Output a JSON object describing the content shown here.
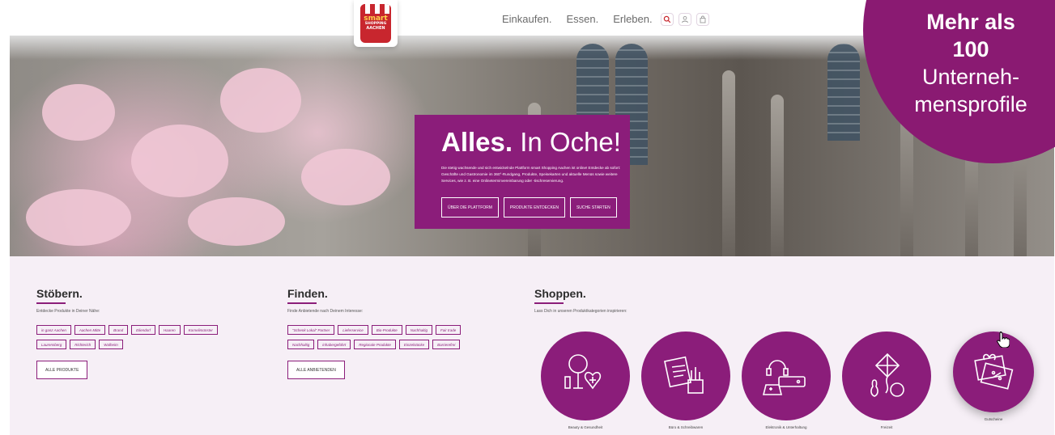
{
  "header": {
    "logo": {
      "line1": "smart",
      "line2": "SHOPPING",
      "line3": "AACHEN"
    },
    "nav": [
      "Einkaufen.",
      "Essen.",
      "Erleben."
    ],
    "icons": [
      "search-icon",
      "user-icon",
      "bag-icon"
    ]
  },
  "hero": {
    "title_bold": "Alles.",
    "title_rest": "In Oche!",
    "text": "Die stetig wachsende und sich entwickelnde Plattform smart Shopping Aachen ist online! Entdecke ab sofort: Geschäfte und Gastronomie im 360°-Rundgang, Produkte, Speisekarten und aktuelle Menüs sowie weitere Services, wie z. B. eine Onlineterminvereinbarung oder -tischreservierung.",
    "buttons": [
      "ÜBER DIE PLATTFORM",
      "PRODUKTE ENTDECKEN",
      "SUCHE STARTEN"
    ]
  },
  "promo": {
    "line1": "Mehr als",
    "line2": "100",
    "line3": "Unterneh-",
    "line4": "mensprofile"
  },
  "stoebern": {
    "title": "Stöbern.",
    "subtitle": "Entdecke Produkte in Deiner Nähe:",
    "tags_row1": [
      "in ganz Aachen",
      "Aachen Mitte",
      "Brand",
      "Eilendorf",
      "Haaren",
      "Kornelimünster"
    ],
    "tags_row2": [
      "Laurensberg",
      "Richterich",
      "Walheim"
    ],
    "button": "ALLE PRODUKTE"
  },
  "finden": {
    "title": "Finden.",
    "subtitle": "Finde Anbietende nach Deinem Interesse:",
    "tags_row1": [
      "\"Schenk Lokal\" Partner",
      "Lieferservice",
      "Bio-Produkte",
      "Nachhaltig",
      "Fair trade"
    ],
    "tags_row2": [
      "Nachhaltig",
      "inhabergeführt",
      "Regionale Produkte",
      "Einzelstücke",
      "Barrierefrei"
    ],
    "button": "ALLE ANBIETENDEN"
  },
  "shoppen": {
    "title": "Shoppen.",
    "subtitle": "Lass Dich in unseren Produktkategorien inspirieren:",
    "categories": [
      "Beauty & Gesundheit",
      "Büro & Schreibwaren",
      "Elektronik & Unterhaltung",
      "Freizeit",
      "Gutscheine"
    ]
  }
}
